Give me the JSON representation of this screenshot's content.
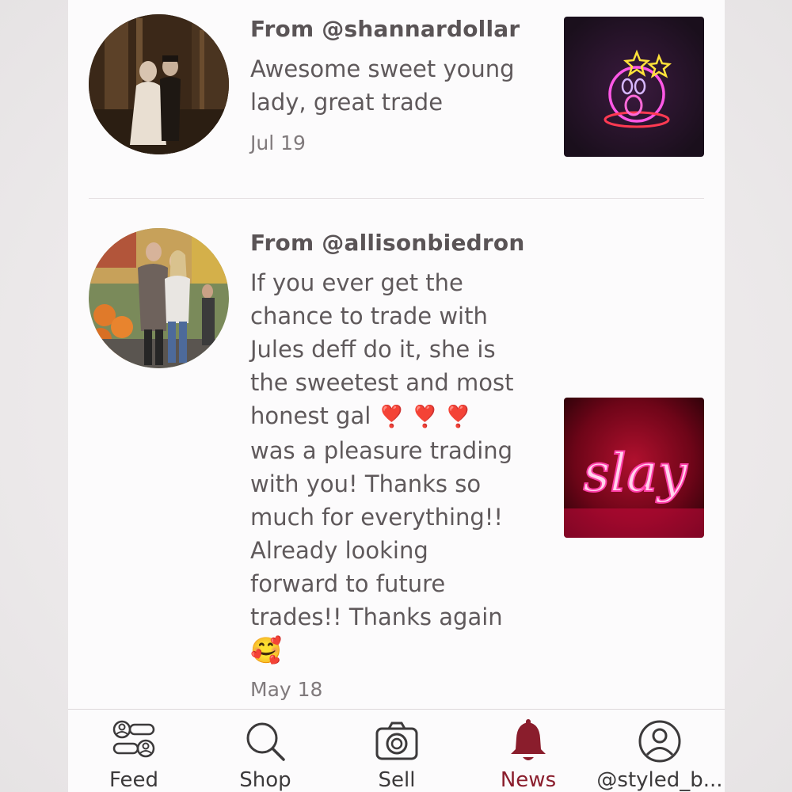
{
  "reviews": [
    {
      "from": "From @shannardollar",
      "lines": [
        "Awesome sweet young",
        "lady, great trade"
      ],
      "date": "Jul 19"
    },
    {
      "from": "From @allisonbiedron",
      "lines": [
        "If you ever get the",
        "chance to trade with",
        "Jules deff do it, she is",
        "the sweetest and most",
        "honest gal",
        "was a pleasure trading",
        "with you! Thanks so",
        "much for everything!!",
        "Already looking",
        "forward to future",
        "trades!! Thanks again"
      ],
      "hearts": "❣️ ❣️ ❣️",
      "emoji": "🥰",
      "thumb_text": "slay",
      "date": "May 18"
    }
  ],
  "tabs": {
    "feed": "Feed",
    "shop": "Shop",
    "sell": "Sell",
    "news": "News",
    "profile": "@styled_b..."
  },
  "icons": {
    "feed": "feed-people-icon",
    "shop": "search-icon",
    "sell": "camera-icon",
    "news": "bell-icon",
    "profile": "user-icon"
  },
  "colors": {
    "active_tab": "#8a1d2c",
    "text": "#5f595b",
    "background": "#fcfbfc"
  }
}
